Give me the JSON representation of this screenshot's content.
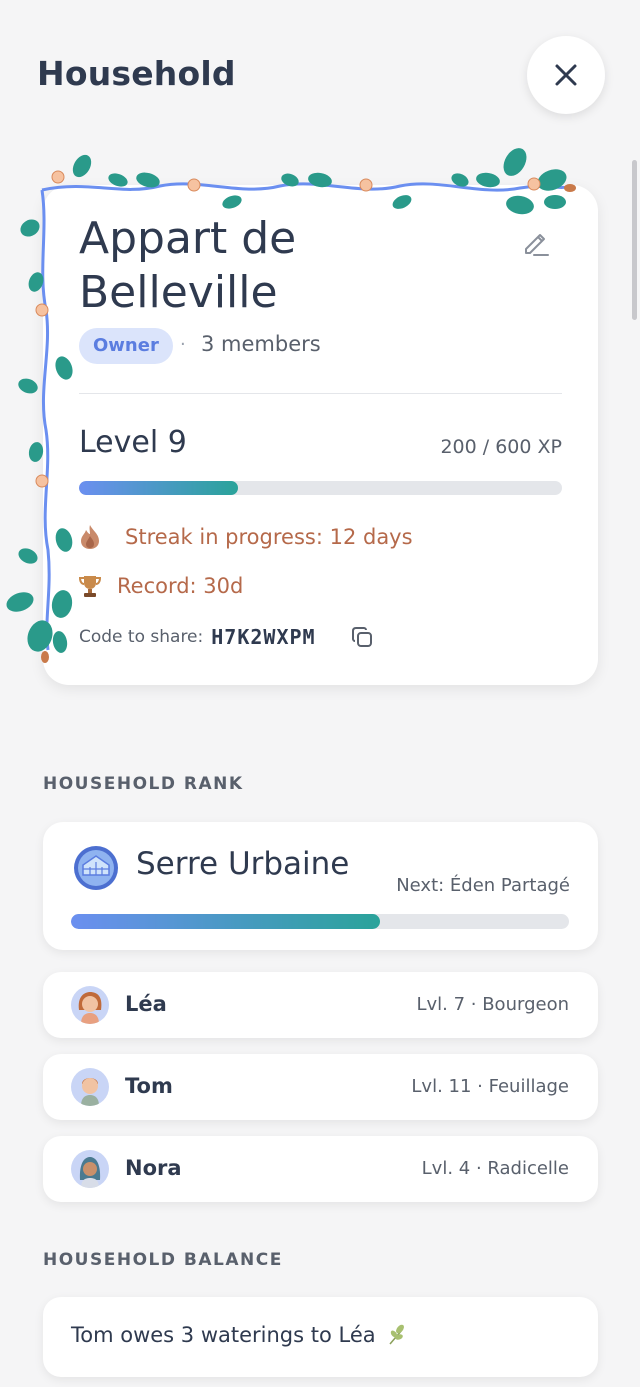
{
  "header": {
    "title": "Household"
  },
  "household": {
    "name": "Appart de Belleville",
    "role_badge": "Owner",
    "separator": "·",
    "members_text": "3 members",
    "level_text": "Level 9",
    "xp_text": "200 / 600 XP",
    "xp_progress": 0.33,
    "streak_text": "Streak in progress: 12 days",
    "record_text": "Record: 30d",
    "code_label": "Code to share:",
    "code_value": "H7K2WXPM"
  },
  "rank_section": {
    "label": "HOUSEHOLD RANK",
    "rank_name": "Serre Urbaine",
    "next_text": "Next: Éden Partagé",
    "progress": 0.62
  },
  "members": [
    {
      "name": "Léa",
      "level_text": "Lvl. 7 · Bourgeon",
      "avatar": "woman-avatar"
    },
    {
      "name": "Tom",
      "level_text": "Lvl. 11 · Feuillage",
      "avatar": "man-avatar"
    },
    {
      "name": "Nora",
      "level_text": "Lvl. 4 · Radicelle",
      "avatar": "hijab-woman-avatar"
    }
  ],
  "balance_section": {
    "label": "HOUSEHOLD BALANCE",
    "text": "Tom owes 3 waterings to Léa"
  },
  "colors": {
    "accent": "#5b7de0",
    "streak": "#b5694a",
    "progress_start": "#6b8ff0",
    "progress_end": "#2aa39a",
    "vine_leaf": "#2a9a8a",
    "vine_stem": "#6b8ff0"
  },
  "icons": {
    "close": "close-icon",
    "edit": "pencil-icon",
    "streak": "flame-icon",
    "record": "trophy-icon",
    "copy": "copy-icon",
    "rank": "greenhouse-emblem-icon",
    "balance": "sprout-icon"
  }
}
